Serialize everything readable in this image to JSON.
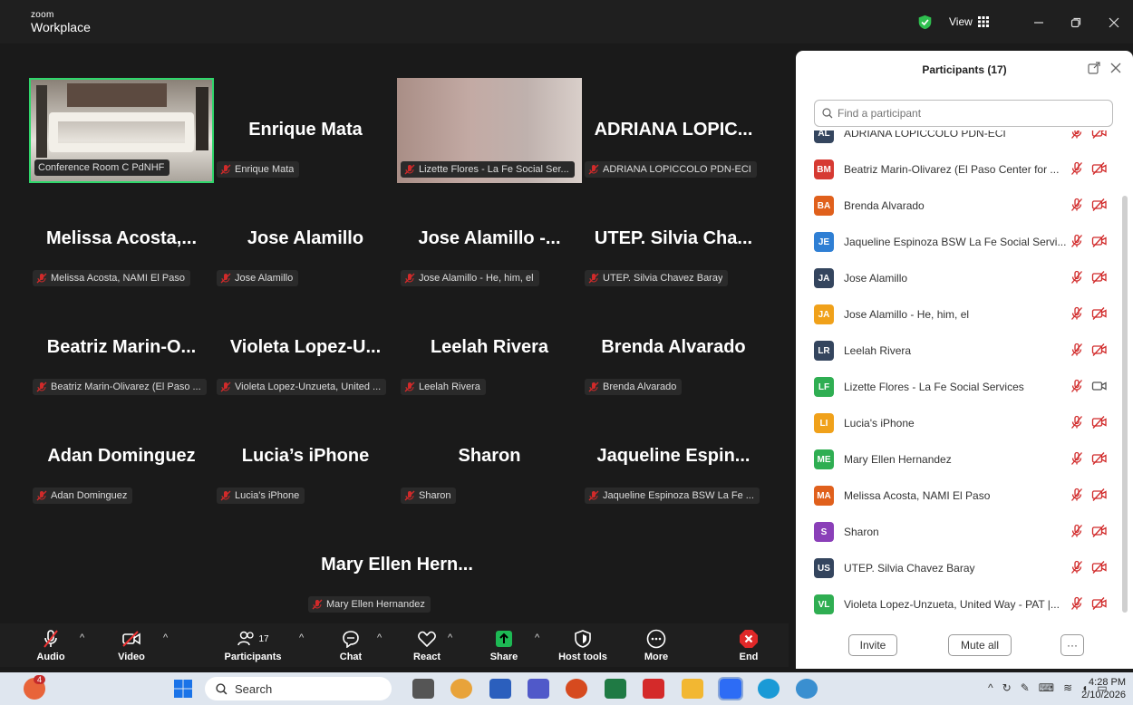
{
  "app": {
    "logo_top": "zoom",
    "logo_bottom": "Workplace"
  },
  "titlebar": {
    "view_label": "View"
  },
  "tiles": [
    {
      "name": "",
      "tag": "Conference Room C PdNHF",
      "type": "video"
    },
    {
      "name": "Enrique Mata",
      "tag": "Enrique Mata",
      "type": "name"
    },
    {
      "name": "",
      "tag": "Lizette Flores - La Fe Social Ser...",
      "type": "blur"
    },
    {
      "name": "ADRIANA LOPIC...",
      "tag": "ADRIANA LOPICCOLO PDN-ECI",
      "type": "name"
    },
    {
      "name": "Melissa Acosta,...",
      "tag": "Melissa Acosta, NAMI El Paso",
      "type": "name"
    },
    {
      "name": "Jose Alamillo",
      "tag": "Jose Alamillo",
      "type": "name"
    },
    {
      "name": "Jose Alamillo -...",
      "tag": "Jose Alamillo - He, him, el",
      "type": "name"
    },
    {
      "name": "UTEP. Silvia Cha...",
      "tag": "UTEP. Silvia Chavez Baray",
      "type": "name"
    },
    {
      "name": "Beatriz Marin-O...",
      "tag": "Beatriz Marin-Olivarez (El Paso ...",
      "type": "name"
    },
    {
      "name": "Violeta Lopez-U...",
      "tag": "Violeta Lopez-Unzueta, United ...",
      "type": "name"
    },
    {
      "name": "Leelah Rivera",
      "tag": "Leelah Rivera",
      "type": "name"
    },
    {
      "name": "Brenda Alvarado",
      "tag": "Brenda Alvarado",
      "type": "name"
    },
    {
      "name": "Adan Dominguez",
      "tag": "Adan Dominguez",
      "type": "name"
    },
    {
      "name": "Lucia’s iPhone",
      "tag": "Lucia's iPhone",
      "type": "name"
    },
    {
      "name": "Sharon",
      "tag": "Sharon",
      "type": "name"
    },
    {
      "name": "Jaqueline Espin...",
      "tag": "Jaqueline Espinoza BSW La Fe ...",
      "type": "name"
    },
    {
      "name": "Mary Ellen Hern...",
      "tag": "Mary Ellen Hernandez",
      "type": "name"
    }
  ],
  "toolbar": {
    "audio": "Audio",
    "video": "Video",
    "participants": "Participants",
    "participants_count": "17",
    "chat": "Chat",
    "react": "React",
    "share": "Share",
    "host_tools": "Host tools",
    "more": "More",
    "end": "End"
  },
  "panel": {
    "title": "Participants (17)",
    "search_placeholder": "Find a participant",
    "invite": "Invite",
    "mute_all": "Mute all",
    "more": "···",
    "participants": [
      {
        "initials": "AL",
        "name": "ADRIANA LOPICCOLO PDN-ECI",
        "color": "#34455e",
        "video": "off"
      },
      {
        "initials": "BM",
        "name": "Beatriz Marin-Olivarez (El Paso Center for ...",
        "color": "#d63a32",
        "video": "off"
      },
      {
        "initials": "BA",
        "name": "Brenda Alvarado",
        "color": "#e0601c",
        "video": "off"
      },
      {
        "initials": "JE",
        "name": "Jaqueline Espinoza BSW La Fe Social Servi...",
        "color": "#2f7fd4",
        "video": "off"
      },
      {
        "initials": "JA",
        "name": "Jose Alamillo",
        "color": "#34455e",
        "video": "off"
      },
      {
        "initials": "JA",
        "name": "Jose Alamillo - He, him, el",
        "color": "#f0a11a",
        "video": "off"
      },
      {
        "initials": "LR",
        "name": "Leelah Rivera",
        "color": "#34455e",
        "video": "off"
      },
      {
        "initials": "LF",
        "name": "Lizette Flores - La Fe Social Services",
        "color": "#2fae52",
        "video": "on"
      },
      {
        "initials": "LI",
        "name": "Lucia's iPhone",
        "color": "#f0a11a",
        "video": "off"
      },
      {
        "initials": "ME",
        "name": "Mary Ellen Hernandez",
        "color": "#2fae52",
        "video": "off"
      },
      {
        "initials": "MA",
        "name": "Melissa Acosta, NAMI El Paso",
        "color": "#e0601c",
        "video": "off"
      },
      {
        "initials": "S",
        "name": "Sharon",
        "color": "#8a3fb8",
        "video": "off"
      },
      {
        "initials": "US",
        "name": "UTEP. Silvia Chavez Baray",
        "color": "#34455e",
        "video": "off"
      },
      {
        "initials": "VL",
        "name": "Violeta Lopez-Unzueta, United Way - PAT |...",
        "color": "#2fae52",
        "video": "off"
      }
    ]
  },
  "taskbar": {
    "search_label": "Search",
    "time": "4:28 PM",
    "date": "2/10/2026",
    "notification_count": "4"
  }
}
